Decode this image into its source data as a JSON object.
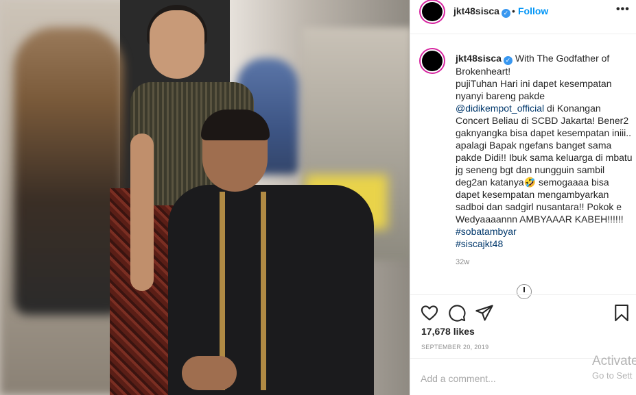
{
  "post": {
    "username": "jkt48sisca",
    "verified_icon": "verified-badge-icon",
    "follow_label": "Follow",
    "more_label": "•••",
    "dot": "•"
  },
  "caption": {
    "username": "jkt48sisca",
    "line1": "With The Godfather of Brokenheart!",
    "line2": "pujiTuhan Hari ini dapet kesempatan nyanyi bareng pakde ",
    "mention": "@didikempot_official",
    "line3": " di Konangan Concert Beliau di SCBD Jakarta! Bener2 gaknyangka bisa dapet kesempatan iniii.. apalagi Bapak ngefans banget sama pakde Didi!! Ibuk sama keluarga di mbatu jg seneng bgt dan nungguin sambil deg2an katanya",
    "emoji": "🤣",
    "line4": " semogaaaa bisa dapet kesempatan mengambyarkan sadboi dan sadgirl nusantara!! Pokok e Wedyaaaannn AMBYAAAR KABEH!!!!!! ",
    "hashtag1": "#sobatambyar",
    "hashtag2": "#siscajkt48",
    "time": "32w"
  },
  "actions": {
    "like_icon": "heart-icon",
    "comment_icon": "comment-icon",
    "share_icon": "share-icon",
    "save_icon": "bookmark-icon"
  },
  "likes": "17,678 likes",
  "date": "SEPTEMBER 20, 2019",
  "comment": {
    "placeholder": "Add a comment..."
  },
  "overlay": {
    "line1": "Activate",
    "line2": "Go to Sett"
  },
  "colors": {
    "link": "#0095f6",
    "mention": "#00376b",
    "muted": "#8e8e8e"
  }
}
